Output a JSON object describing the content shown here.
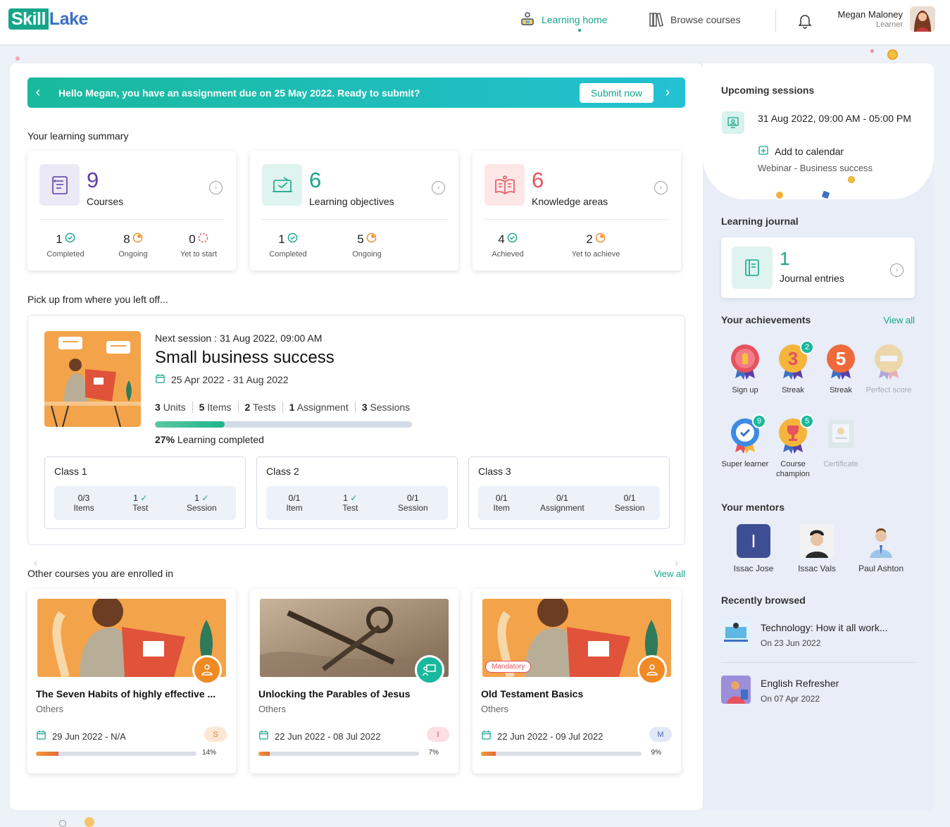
{
  "brand": {
    "logo_left": "Skill",
    "logo_right": "Lake"
  },
  "nav": {
    "learning_home": "Learning home",
    "browse_courses": "Browse courses"
  },
  "user": {
    "name": "Megan Maloney",
    "role": "Learner"
  },
  "banner": {
    "message": "Hello Megan, you have an assignment due on 25 May 2022. Ready to submit?",
    "button": "Submit now"
  },
  "summary": {
    "title": "Your learning summary",
    "courses": {
      "count": "9",
      "label": "Courses",
      "stats": [
        {
          "value": "1",
          "label": "Completed"
        },
        {
          "value": "8",
          "label": "Ongoing"
        },
        {
          "value": "0",
          "label": "Yet to start"
        }
      ]
    },
    "objectives": {
      "count": "6",
      "label": "Learning objectives",
      "stats": [
        {
          "value": "1",
          "label": "Completed"
        },
        {
          "value": "5",
          "label": "Ongoing"
        }
      ]
    },
    "knowledge": {
      "count": "6",
      "label": "Knowledge areas",
      "stats": [
        {
          "value": "4",
          "label": "Achieved"
        },
        {
          "value": "2",
          "label": "Yet to achieve"
        }
      ]
    }
  },
  "pickup": {
    "title": "Pick up from where you left off...",
    "next_session": "Next session : 31 Aug 2022, 09:00 AM",
    "course_title": "Small business success",
    "dates": "25 Apr 2022 - 31 Aug 2022",
    "counts": [
      {
        "n": "3",
        "label": "Units"
      },
      {
        "n": "5",
        "label": "Items"
      },
      {
        "n": "2",
        "label": "Tests"
      },
      {
        "n": "1",
        "label": "Assignment"
      },
      {
        "n": "3",
        "label": "Sessions"
      }
    ],
    "progress_percent": 27,
    "progress_label": "27%",
    "progress_text": "Learning completed",
    "classes": [
      {
        "name": "Class 1",
        "stats": [
          {
            "v": "0/3",
            "l": "Items",
            "check": false
          },
          {
            "v": "1",
            "l": "Test",
            "check": true
          },
          {
            "v": "1",
            "l": "Session",
            "check": true
          }
        ]
      },
      {
        "name": "Class 2",
        "stats": [
          {
            "v": "0/1",
            "l": "Item",
            "check": false
          },
          {
            "v": "1",
            "l": "Test",
            "check": true
          },
          {
            "v": "0/1",
            "l": "Session",
            "check": false
          }
        ]
      },
      {
        "name": "Class 3",
        "stats": [
          {
            "v": "0/1",
            "l": "Item",
            "check": false
          },
          {
            "v": "0/1",
            "l": "Assignment",
            "check": false
          },
          {
            "v": "0/1",
            "l": "Session",
            "check": false
          }
        ]
      }
    ]
  },
  "other": {
    "title": "Other courses you are enrolled in",
    "view_all": "View all",
    "courses": [
      {
        "title": "The Seven Habits of highly effective ...",
        "category": "Others",
        "dates": "29 Jun 2022 - N/A",
        "chip": "S",
        "chip_bg": "#fde6d3",
        "chip_fg": "#d9822b",
        "progress": 14,
        "progress_label": "14%",
        "mandatory": ""
      },
      {
        "title": "Unlocking the Parables of Jesus",
        "category": "Others",
        "dates": "22 Jun 2022 - 08 Jul 2022",
        "chip": "I",
        "chip_bg": "#fbdfe2",
        "chip_fg": "#d9414f",
        "progress": 7,
        "progress_label": "7%",
        "mandatory": ""
      },
      {
        "title": "Old Testament Basics",
        "category": "Others",
        "dates": "22 Jun 2022 - 09 Jul 2022",
        "chip": "M",
        "chip_bg": "#e2e8f7",
        "chip_fg": "#4b64b0",
        "progress": 9,
        "progress_label": "9%",
        "mandatory": "Mandatory"
      }
    ]
  },
  "upcoming": {
    "title": "Upcoming sessions",
    "time": "31 Aug 2022, 09:00 AM - 05:00 PM",
    "add_calendar": "Add to calendar",
    "type": "Webinar - Business success"
  },
  "journal": {
    "title": "Learning journal",
    "count": "1",
    "label": "Journal entries"
  },
  "achievements": {
    "title": "Your achievements",
    "view_all": "View all",
    "items": [
      {
        "label": "Sign up",
        "count": ""
      },
      {
        "label": "Streak",
        "count": "2"
      },
      {
        "label": "Streak",
        "count": ""
      },
      {
        "label": "Perfect score",
        "count": ""
      },
      {
        "label": "Super learner",
        "count": "9"
      },
      {
        "label": "Course champion",
        "count": "5"
      },
      {
        "label": "Certificate",
        "count": ""
      }
    ]
  },
  "mentors": {
    "title": "Your mentors",
    "items": [
      {
        "name": "Issac Jose",
        "initial": "I"
      },
      {
        "name": "Issac Vals"
      },
      {
        "name": "Paul Ashton"
      }
    ]
  },
  "recent": {
    "title": "Recently browsed",
    "items": [
      {
        "title": "Technology: How it all work...",
        "date": "On 23 Jun 2022"
      },
      {
        "title": "English Refresher",
        "date": "On 07 Apr 2022"
      }
    ]
  },
  "colors": {
    "accent": "#16a58a",
    "brand_blue": "#3d6fc5",
    "orange": "#f08a24",
    "red": "#e5535e"
  }
}
